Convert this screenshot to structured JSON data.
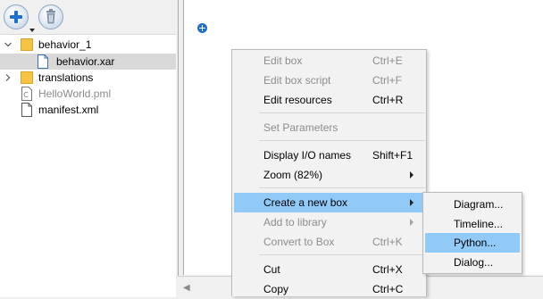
{
  "toolbar": {
    "add_icon": "plus-icon",
    "delete_icon": "trash-icon"
  },
  "tree": {
    "items": [
      {
        "label": "behavior_1",
        "icon": "folder-icon",
        "expanded": true
      },
      {
        "label": "behavior.xar",
        "icon": "file-icon",
        "selected": true
      },
      {
        "label": "translations",
        "icon": "folder-icon",
        "expanded": false
      },
      {
        "label": "HelloWorld.pml",
        "icon": "choregraphe-file-icon",
        "dimmed": true
      },
      {
        "label": "manifest.xml",
        "icon": "file-icon"
      }
    ]
  },
  "context_menu": {
    "items": [
      {
        "label": "Edit box",
        "shortcut": "Ctrl+E",
        "disabled": true
      },
      {
        "label": "Edit box script",
        "shortcut": "Ctrl+F",
        "disabled": true
      },
      {
        "label": "Edit resources",
        "shortcut": "Ctrl+R",
        "disabled": false
      },
      {
        "label": "Set Parameters",
        "shortcut": "",
        "disabled": true
      },
      {
        "label": "Display I/O names",
        "shortcut": "Shift+F1",
        "disabled": false
      },
      {
        "label": "Zoom (82%)",
        "shortcut": "",
        "disabled": false,
        "submenu": true
      },
      {
        "label": "Create a new box",
        "shortcut": "",
        "disabled": false,
        "submenu": true,
        "highlighted": true
      },
      {
        "label": "Add to library",
        "shortcut": "",
        "disabled": true,
        "submenu": true
      },
      {
        "label": "Convert to Box",
        "shortcut": "Ctrl+K",
        "disabled": true
      },
      {
        "label": "Cut",
        "shortcut": "Ctrl+X",
        "disabled": false
      },
      {
        "label": "Copy",
        "shortcut": "Ctrl+C",
        "disabled": false
      }
    ]
  },
  "submenu": {
    "items": [
      {
        "label": "Diagram..."
      },
      {
        "label": "Timeline..."
      },
      {
        "label": "Python...",
        "highlighted": true
      },
      {
        "label": "Dialog..."
      }
    ]
  },
  "colors": {
    "highlight": "#91c9f7",
    "accent": "#1f6fd0",
    "folder": "#f6c343"
  }
}
